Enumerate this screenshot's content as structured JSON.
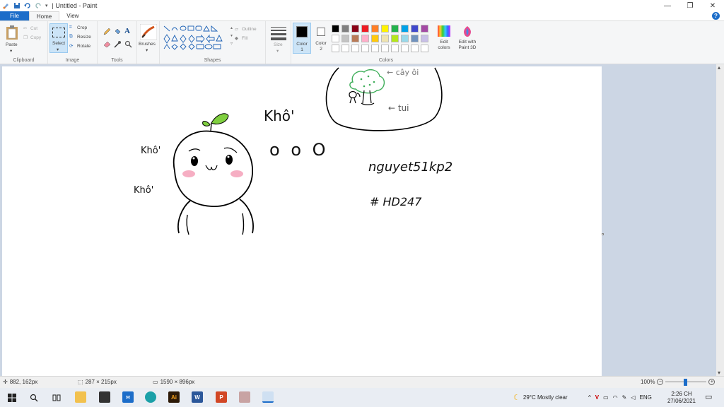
{
  "window": {
    "title": "| Untitled - Paint"
  },
  "tabs": [
    {
      "label": "File"
    },
    {
      "label": "Home"
    },
    {
      "label": "View"
    }
  ],
  "help_label": "?",
  "ribbon": {
    "clipboard": {
      "paste": "Paste",
      "cut": "Cut",
      "copy": "Copy",
      "label": "Clipboard"
    },
    "image": {
      "select": "Select",
      "crop": "Crop",
      "resize": "Resize",
      "rotate": "Rotate",
      "label": "Image"
    },
    "tools": {
      "label": "Tools"
    },
    "brushes": {
      "label": "Brushes"
    },
    "shapes": {
      "outline": "Outline",
      "fill": "Fill",
      "label": "Shapes"
    },
    "size": {
      "label": "Size"
    },
    "colors": {
      "color1": "Color 1",
      "color2": "Color 2",
      "edit_colors": "Edit colors",
      "edit_paint3d": "Edit with Paint 3D",
      "label": "Colors",
      "palette_row1": [
        "#000000",
        "#7f7f7f",
        "#880015",
        "#ed1c24",
        "#ff7f27",
        "#fff200",
        "#22b14c",
        "#00a2e8",
        "#3f48cc",
        "#a349a4"
      ],
      "palette_row2": [
        "#ffffff",
        "#c3c3c3",
        "#b97a57",
        "#ffaec9",
        "#ffc90e",
        "#efe4b0",
        "#b5e61d",
        "#99d9ea",
        "#7092be",
        "#c8bfe7"
      ],
      "color1_value": "#000000",
      "color2_value": "#ffffff"
    }
  },
  "drawing": {
    "texts": {
      "kho1": "Khô'",
      "kho2": "Khô'",
      "kho3": "Khô'",
      "ooo": "o o O",
      "cay_oi": "← cây ôi",
      "tui": "← tui",
      "signature": "nguyet51kp2",
      "hashtag": "# HD247"
    },
    "colors": {
      "sprout": "#7fcf3f",
      "blush": "#f4a0b8",
      "tree": "#3fae5a"
    }
  },
  "status": {
    "cursor": "882, 162px",
    "selection": "287 × 215px",
    "canvas_size": "1590 × 896px",
    "zoom": "100%",
    "zoom_value": 100
  },
  "taskbar": {
    "weather": "29°C Mostly clear",
    "lang": "ENG",
    "time": "2:26 CH",
    "date": "27/06/2021"
  }
}
